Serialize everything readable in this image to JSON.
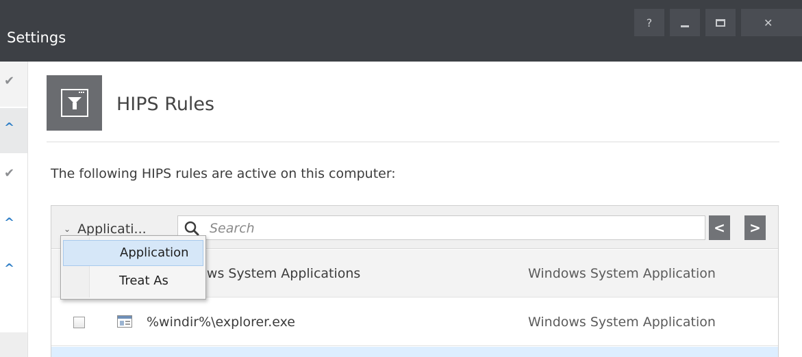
{
  "window": {
    "title": "Settings",
    "controls": {
      "help": "?",
      "close": "✕"
    }
  },
  "header": {
    "title": "HIPS Rules",
    "icon": "filter-icon"
  },
  "description": "The following HIPS rules are active on this computer:",
  "toolbar": {
    "filter_label": "Applicati...",
    "search_placeholder": "Search",
    "clear_label": "✖",
    "prev_label": "<",
    "next_label": ">"
  },
  "filter_menu": {
    "items": [
      "Application",
      "Treat As"
    ],
    "selected": "Application"
  },
  "rules": {
    "group": {
      "name": "lows System Applications",
      "treat_as": "Windows System Application"
    },
    "items": [
      {
        "name": "%windir%\\explorer.exe",
        "treat_as": "Windows System Application",
        "checked": false
      }
    ]
  },
  "sidebar": {
    "icons": [
      "check-icon",
      "chevron-up-icon",
      "check-icon",
      "chevron-up-icon",
      "chevron-up-icon"
    ]
  },
  "colors": {
    "titlebar": "#3d4045",
    "accent": "#2e7ec6",
    "icon_tile": "#6a6c70",
    "selection": "#d6e7f8"
  }
}
